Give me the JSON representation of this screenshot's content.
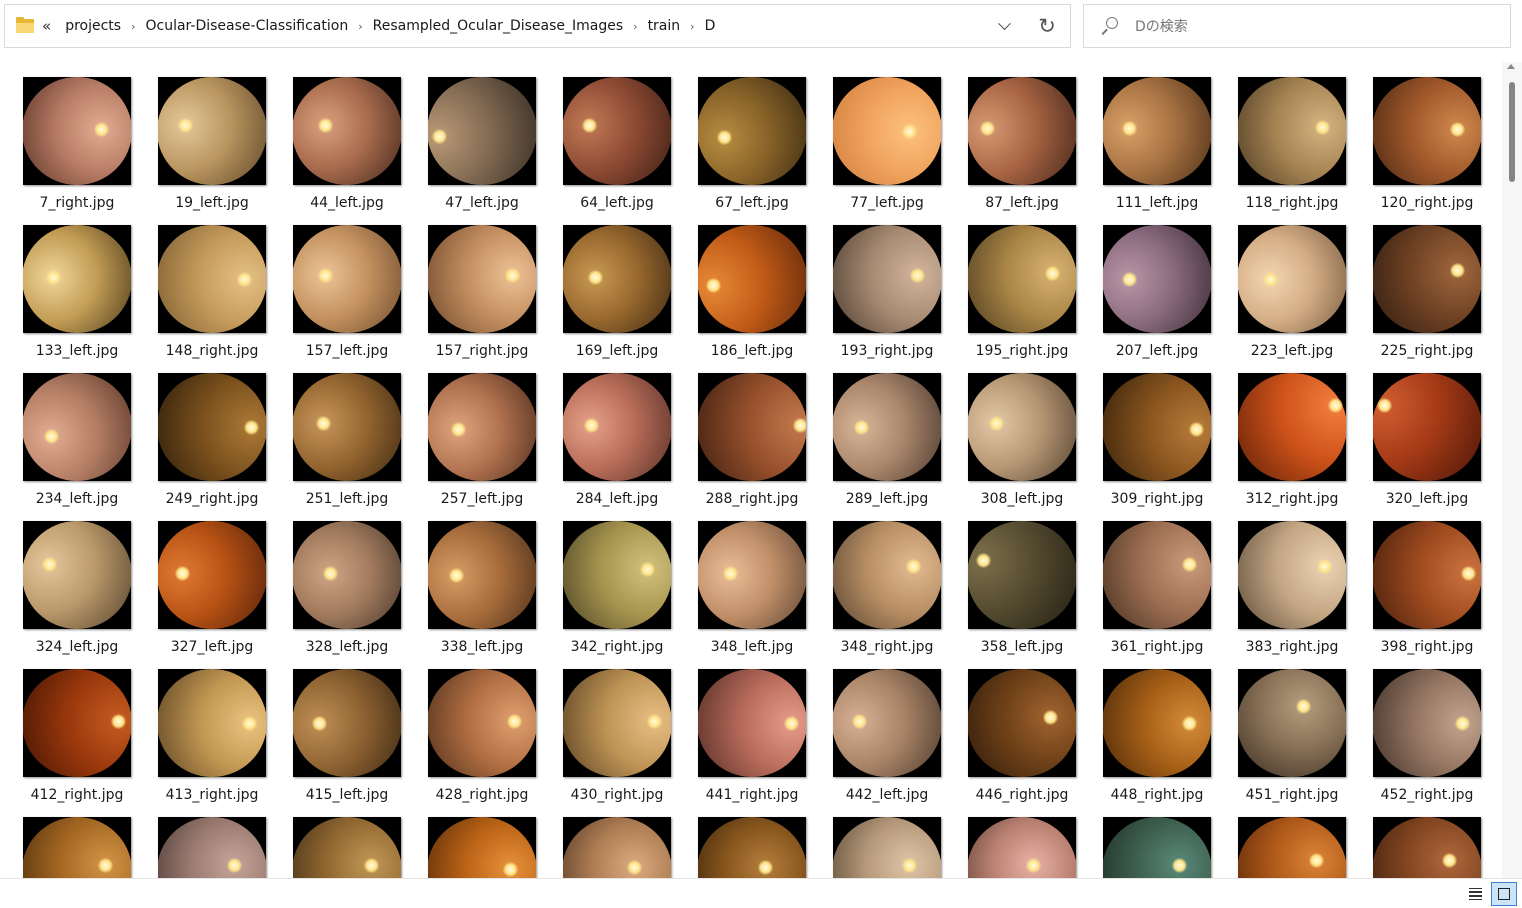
{
  "address": {
    "folder_icon": "folder-icon",
    "overflow": "«",
    "breadcrumbs": [
      "projects",
      "Ocular-Disease-Classification",
      "Resampled_Ocular_Disease_Images",
      "train",
      "D"
    ],
    "separator": "›",
    "dropdown_icon": "chevron-down-icon",
    "refresh_icon": "refresh-icon",
    "refresh_glyph": "↻"
  },
  "search": {
    "icon": "search-icon",
    "placeholder": "Dの検索"
  },
  "files": [
    {
      "name": "7_right.jpg",
      "c": [
        "#e3ad93",
        "#b77c65",
        "#5a3226"
      ],
      "disc": [
        72,
        48
      ]
    },
    {
      "name": "19_left.jpg",
      "c": [
        "#e4c89b",
        "#b9955f",
        "#5d4527"
      ],
      "disc": [
        25,
        44
      ]
    },
    {
      "name": "44_left.jpg",
      "c": [
        "#d9a17e",
        "#a86b4d",
        "#3f2519"
      ],
      "disc": [
        30,
        44
      ]
    },
    {
      "name": "47_left.jpg",
      "c": [
        "#ba9a77",
        "#826a52",
        "#332a22"
      ],
      "disc": [
        10,
        55
      ]
    },
    {
      "name": "64_left.jpg",
      "c": [
        "#c17a56",
        "#8e4b34",
        "#3a1d13"
      ],
      "disc": [
        24,
        44
      ]
    },
    {
      "name": "67_left.jpg",
      "c": [
        "#b98d41",
        "#876228",
        "#362510"
      ],
      "disc": [
        24,
        56
      ]
    },
    {
      "name": "77_left.jpg",
      "c": [
        "#fcc27f",
        "#f0a35d",
        "#d07d3c"
      ],
      "disc": [
        70,
        50
      ]
    },
    {
      "name": "87_left.jpg",
      "c": [
        "#d69a72",
        "#a76443",
        "#45261a"
      ],
      "disc": [
        18,
        47
      ]
    },
    {
      "name": "111_left.jpg",
      "c": [
        "#d9a169",
        "#a77242",
        "#4d2f17"
      ],
      "disc": [
        24,
        47
      ]
    },
    {
      "name": "118_right.jpg",
      "c": [
        "#d6b482",
        "#a78453",
        "#4b3a23"
      ],
      "disc": [
        78,
        46
      ]
    },
    {
      "name": "120_right.jpg",
      "c": [
        "#d0894d",
        "#a1592b",
        "#4a2712"
      ],
      "disc": [
        78,
        48
      ]
    },
    {
      "name": "133_left.jpg",
      "c": [
        "#f1d79b",
        "#c29d55",
        "#4f3a1b"
      ],
      "disc": [
        28,
        48
      ]
    },
    {
      "name": "148_right.jpg",
      "c": [
        "#e5c186",
        "#c49a5a",
        "#7b5d31"
      ],
      "disc": [
        80,
        50
      ]
    },
    {
      "name": "157_left.jpg",
      "c": [
        "#ecc596",
        "#c4915f",
        "#6c4a2c"
      ],
      "disc": [
        30,
        46
      ]
    },
    {
      "name": "157_right.jpg",
      "c": [
        "#eec295",
        "#c38e5f",
        "#6c462b"
      ],
      "disc": [
        78,
        46
      ]
    },
    {
      "name": "169_left.jpg",
      "c": [
        "#c99a53",
        "#98682e",
        "#3d2812"
      ],
      "disc": [
        30,
        48
      ]
    },
    {
      "name": "186_left.jpg",
      "c": [
        "#e78a37",
        "#c15b17",
        "#5e260a"
      ],
      "disc": [
        14,
        56
      ]
    },
    {
      "name": "193_right.jpg",
      "c": [
        "#d2b59c",
        "#a78a72",
        "#4a3b30"
      ],
      "disc": [
        78,
        46
      ]
    },
    {
      "name": "195_right.jpg",
      "c": [
        "#d8b372",
        "#a98546",
        "#4c3a1e"
      ],
      "disc": [
        78,
        44
      ]
    },
    {
      "name": "207_left.jpg",
      "c": [
        "#b997a6",
        "#8a6b7e",
        "#3c2c36"
      ],
      "disc": [
        24,
        50
      ]
    },
    {
      "name": "223_left.jpg",
      "c": [
        "#f3d6b2",
        "#d4ad85",
        "#7a5d42"
      ],
      "disc": [
        30,
        50
      ]
    },
    {
      "name": "225_right.jpg",
      "c": [
        "#a0673d",
        "#6f4224",
        "#2d1a0e"
      ],
      "disc": [
        78,
        42
      ]
    },
    {
      "name": "234_left.jpg",
      "c": [
        "#e2ad91",
        "#b47e64",
        "#553426"
      ],
      "disc": [
        26,
        58
      ]
    },
    {
      "name": "249_right.jpg",
      "c": [
        "#ad7a36",
        "#7b511d",
        "#2f1e0b"
      ],
      "disc": [
        86,
        50
      ]
    },
    {
      "name": "251_left.jpg",
      "c": [
        "#c8965d",
        "#94652f",
        "#3c2812"
      ],
      "disc": [
        28,
        46
      ]
    },
    {
      "name": "257_left.jpg",
      "c": [
        "#dea57e",
        "#b0714f",
        "#4c2c1b"
      ],
      "disc": [
        28,
        52
      ]
    },
    {
      "name": "284_left.jpg",
      "c": [
        "#e6a28a",
        "#b76c58",
        "#573027"
      ],
      "disc": [
        26,
        48
      ]
    },
    {
      "name": "288_right.jpg",
      "c": [
        "#c47a4e",
        "#96502c",
        "#3e1f10"
      ],
      "disc": [
        94,
        48
      ]
    },
    {
      "name": "289_left.jpg",
      "c": [
        "#d7b598",
        "#aa866b",
        "#4a3a2f"
      ],
      "disc": [
        26,
        50
      ]
    },
    {
      "name": "308_left.jpg",
      "c": [
        "#e3c9a6",
        "#b69774",
        "#52402f"
      ],
      "disc": [
        26,
        46
      ]
    },
    {
      "name": "309_right.jpg",
      "c": [
        "#b87c3a",
        "#88541e",
        "#38220b"
      ],
      "disc": [
        86,
        52
      ]
    },
    {
      "name": "312_right.jpg",
      "c": [
        "#f37f3d",
        "#cd521a",
        "#5f1f07"
      ],
      "disc": [
        90,
        30
      ]
    },
    {
      "name": "320_left.jpg",
      "c": [
        "#d25f31",
        "#a53a17",
        "#4a1607"
      ],
      "disc": [
        10,
        30
      ]
    },
    {
      "name": "324_left.jpg",
      "c": [
        "#e6c69b",
        "#b9986a",
        "#53412b"
      ],
      "disc": [
        24,
        40
      ]
    },
    {
      "name": "327_left.jpg",
      "c": [
        "#df7a33",
        "#b65114",
        "#55220a"
      ],
      "disc": [
        22,
        48
      ]
    },
    {
      "name": "328_left.jpg",
      "c": [
        "#cfa585",
        "#a27b5e",
        "#463529"
      ],
      "disc": [
        34,
        48
      ]
    },
    {
      "name": "338_left.jpg",
      "c": [
        "#d79d67",
        "#a96d3c",
        "#4b2f19"
      ],
      "disc": [
        26,
        50
      ]
    },
    {
      "name": "342_right.jpg",
      "c": [
        "#d2c27e",
        "#a6944e",
        "#4c4324"
      ],
      "disc": [
        78,
        44
      ]
    },
    {
      "name": "348_left.jpg",
      "c": [
        "#ebbd97",
        "#c08f69",
        "#5c4330"
      ],
      "disc": [
        30,
        48
      ]
    },
    {
      "name": "348_right.jpg",
      "c": [
        "#e3bb91",
        "#b88f64",
        "#554130"
      ],
      "disc": [
        74,
        42
      ]
    },
    {
      "name": "358_left.jpg",
      "c": [
        "#7c6f4a",
        "#544a2f",
        "#221e12"
      ],
      "disc": [
        14,
        36
      ]
    },
    {
      "name": "361_right.jpg",
      "c": [
        "#cb9a7c",
        "#9c6e52",
        "#45301f"
      ],
      "disc": [
        80,
        40
      ]
    },
    {
      "name": "383_right.jpg",
      "c": [
        "#ecd3b3",
        "#c3a684",
        "#5a4a38"
      ],
      "disc": [
        80,
        42
      ]
    },
    {
      "name": "398_right.jpg",
      "c": [
        "#cc7440",
        "#9f4a1f",
        "#46200c"
      ],
      "disc": [
        88,
        48
      ]
    },
    {
      "name": "412_right.jpg",
      "c": [
        "#c75c22",
        "#9a380c",
        "#451503"
      ],
      "disc": [
        88,
        48
      ]
    },
    {
      "name": "413_right.jpg",
      "c": [
        "#ebc37f",
        "#c29752",
        "#5e4525"
      ],
      "disc": [
        84,
        50
      ]
    },
    {
      "name": "415_left.jpg",
      "c": [
        "#bf8f55",
        "#8f6332",
        "#3b2814"
      ],
      "disc": [
        24,
        50
      ]
    },
    {
      "name": "428_right.jpg",
      "c": [
        "#dfa06f",
        "#b16e42",
        "#50311c"
      ],
      "disc": [
        80,
        48
      ]
    },
    {
      "name": "430_right.jpg",
      "c": [
        "#e8bf85",
        "#be9354",
        "#5a4223"
      ],
      "disc": [
        84,
        48
      ]
    },
    {
      "name": "441_right.jpg",
      "c": [
        "#e79c8b",
        "#b86b5b",
        "#562e26"
      ],
      "disc": [
        86,
        50
      ]
    },
    {
      "name": "442_left.jpg",
      "c": [
        "#d8b195",
        "#aa8467",
        "#4b3a2d"
      ],
      "disc": [
        24,
        48
      ]
    },
    {
      "name": "446_right.jpg",
      "c": [
        "#a1642f",
        "#6f4118",
        "#2d1a0a"
      ],
      "disc": [
        76,
        44
      ]
    },
    {
      "name": "448_right.jpg",
      "c": [
        "#d48c38",
        "#a65f17",
        "#4d2a09"
      ],
      "disc": [
        80,
        50
      ]
    },
    {
      "name": "451_right.jpg",
      "c": [
        "#b59e7d",
        "#866f54",
        "#392e23"
      ],
      "disc": [
        60,
        34
      ]
    },
    {
      "name": "452_right.jpg",
      "c": [
        "#c3a48f",
        "#947562",
        "#3f3128"
      ],
      "disc": [
        82,
        50
      ]
    },
    {
      "name": "",
      "c": [
        "#d39546",
        "#a46722",
        "#4a2c0c"
      ],
      "disc": [
        76,
        44
      ]
    },
    {
      "name": "",
      "c": [
        "#c6a59a",
        "#9a7a70",
        "#43342f"
      ],
      "disc": [
        70,
        44
      ]
    },
    {
      "name": "",
      "c": [
        "#c29857",
        "#916831",
        "#3d2a14"
      ],
      "disc": [
        72,
        44
      ]
    },
    {
      "name": "",
      "c": [
        "#e7923b",
        "#bb6317",
        "#572a08"
      ],
      "disc": [
        76,
        48
      ]
    },
    {
      "name": "",
      "c": [
        "#dcab80",
        "#ae7d54",
        "#4f3522"
      ],
      "disc": [
        66,
        46
      ]
    },
    {
      "name": "",
      "c": [
        "#b67e3d",
        "#87561d",
        "#36210b"
      ],
      "disc": [
        62,
        46
      ]
    },
    {
      "name": "",
      "c": [
        "#e1c5a8",
        "#b49879",
        "#51412f"
      ],
      "disc": [
        70,
        44
      ]
    },
    {
      "name": "",
      "c": [
        "#e8b2a4",
        "#bb8273",
        "#56392f"
      ],
      "disc": [
        60,
        44
      ]
    },
    {
      "name": "",
      "c": [
        "#5a8a7a",
        "#3d5e4d",
        "#1a2a22"
      ],
      "disc": [
        70,
        44
      ]
    },
    {
      "name": "",
      "c": [
        "#dc8437",
        "#ad5718",
        "#4f2308"
      ],
      "disc": [
        72,
        40
      ]
    },
    {
      "name": "",
      "c": [
        "#b0683c",
        "#804420",
        "#341a0b"
      ],
      "disc": [
        70,
        40
      ]
    }
  ],
  "status": {
    "details_view_icon": "details-view-icon",
    "large_icons_view_icon": "large-icons-view-icon"
  }
}
